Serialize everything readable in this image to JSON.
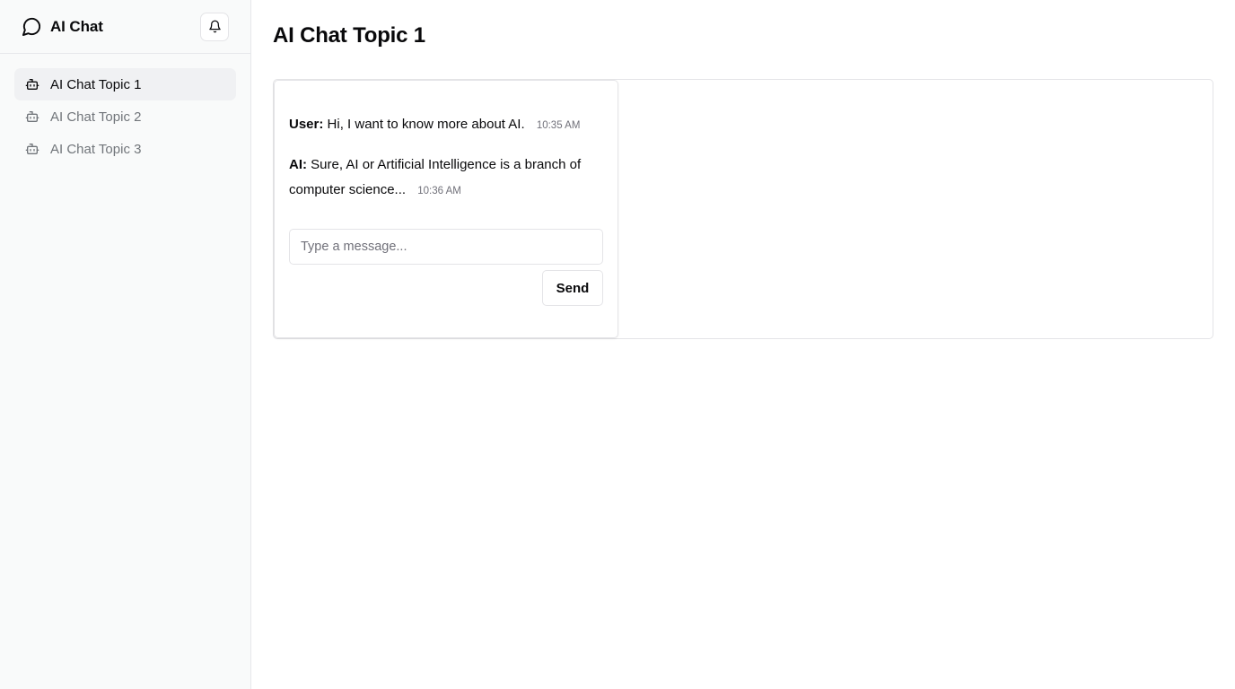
{
  "app": {
    "title": "AI Chat",
    "brand_icon": "message-circle-icon",
    "notification_icon": "bell-icon"
  },
  "sidebar": {
    "items": [
      {
        "label": "AI Chat Topic 1",
        "icon": "bot-icon",
        "active": true
      },
      {
        "label": "AI Chat Topic 2",
        "icon": "bot-icon",
        "active": false
      },
      {
        "label": "AI Chat Topic 3",
        "icon": "bot-icon",
        "active": false
      }
    ]
  },
  "main": {
    "title": "AI Chat Topic 1",
    "messages": [
      {
        "sender": "User:",
        "text": "Hi, I want to know more about AI.",
        "time": "10:35 AM"
      },
      {
        "sender": "AI:",
        "text": "Sure, AI or Artificial Intelligence is a branch of computer science...",
        "time": "10:36 AM"
      }
    ],
    "input": {
      "value": "",
      "placeholder": "Type a message..."
    },
    "send_label": "Send"
  },
  "colors": {
    "sidebar_bg": "#f9fafa",
    "active_item_bg": "#f0f1f3",
    "border": "#e4e4e7",
    "muted_text": "#71717a",
    "primary_text": "#09090b"
  }
}
